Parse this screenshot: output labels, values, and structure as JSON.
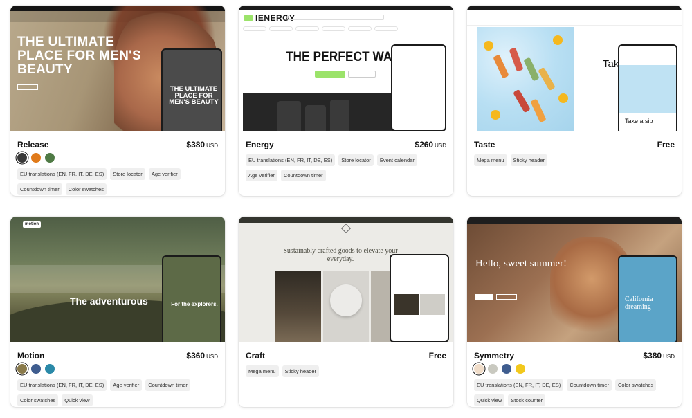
{
  "themes": [
    {
      "name": "Release",
      "price": "$380",
      "currency": "USD",
      "swatches": [
        "#3a3a3a",
        "#e07a1a",
        "#4f7a45"
      ],
      "tags": [
        "EU translations (EN, FR, IT, DE, ES)",
        "Store locator",
        "Age verifier",
        "Countdown timer",
        "Color swatches"
      ],
      "preview_headline": "THE ULTIMATE PLACE FOR MEN'S BEAUTY",
      "preview_phone_headline": "THE ULTIMATE PLACE FOR MEN'S BEAUTY"
    },
    {
      "name": "Energy",
      "price": "$260",
      "currency": "USD",
      "swatches": [],
      "tags": [
        "EU translations (EN, FR, IT, DE, ES)",
        "Store locator",
        "Event calendar",
        "Age verifier",
        "Countdown timer"
      ],
      "preview_brand": "IENERGY",
      "preview_headline": "THE PERFECT WARM-"
    },
    {
      "name": "Taste",
      "price": "Free",
      "currency": "",
      "swatches": [],
      "tags": [
        "Mega menu",
        "Sticky header"
      ],
      "preview_headline": "Take",
      "preview_phone_headline": "Take a sip"
    },
    {
      "name": "Motion",
      "price": "$360",
      "currency": "USD",
      "swatches": [
        "#8a7a4a",
        "#3f5d8f",
        "#2a89a8"
      ],
      "tags": [
        "EU translations (EN, FR, IT, DE, ES)",
        "Age verifier",
        "Countdown timer",
        "Color swatches",
        "Quick view"
      ],
      "preview_logo": "motion",
      "preview_headline": "The adventurous",
      "preview_phone_headline": "For the explorers."
    },
    {
      "name": "Craft",
      "price": "Free",
      "currency": "",
      "swatches": [],
      "tags": [
        "Mega menu",
        "Sticky header"
      ],
      "preview_headline": "Sustainably crafted goods to elevate your everyday."
    },
    {
      "name": "Symmetry",
      "price": "$380",
      "currency": "USD",
      "swatches": [
        "#f0dcc8",
        "#c9c9c0",
        "#3f5d8f",
        "#f2c81c"
      ],
      "tags": [
        "EU translations (EN, FR, IT, DE, ES)",
        "Countdown timer",
        "Color swatches",
        "Quick view",
        "Stock counter"
      ],
      "preview_headline": "Hello, sweet summer!",
      "preview_phone_headline": "California dreaming"
    }
  ]
}
